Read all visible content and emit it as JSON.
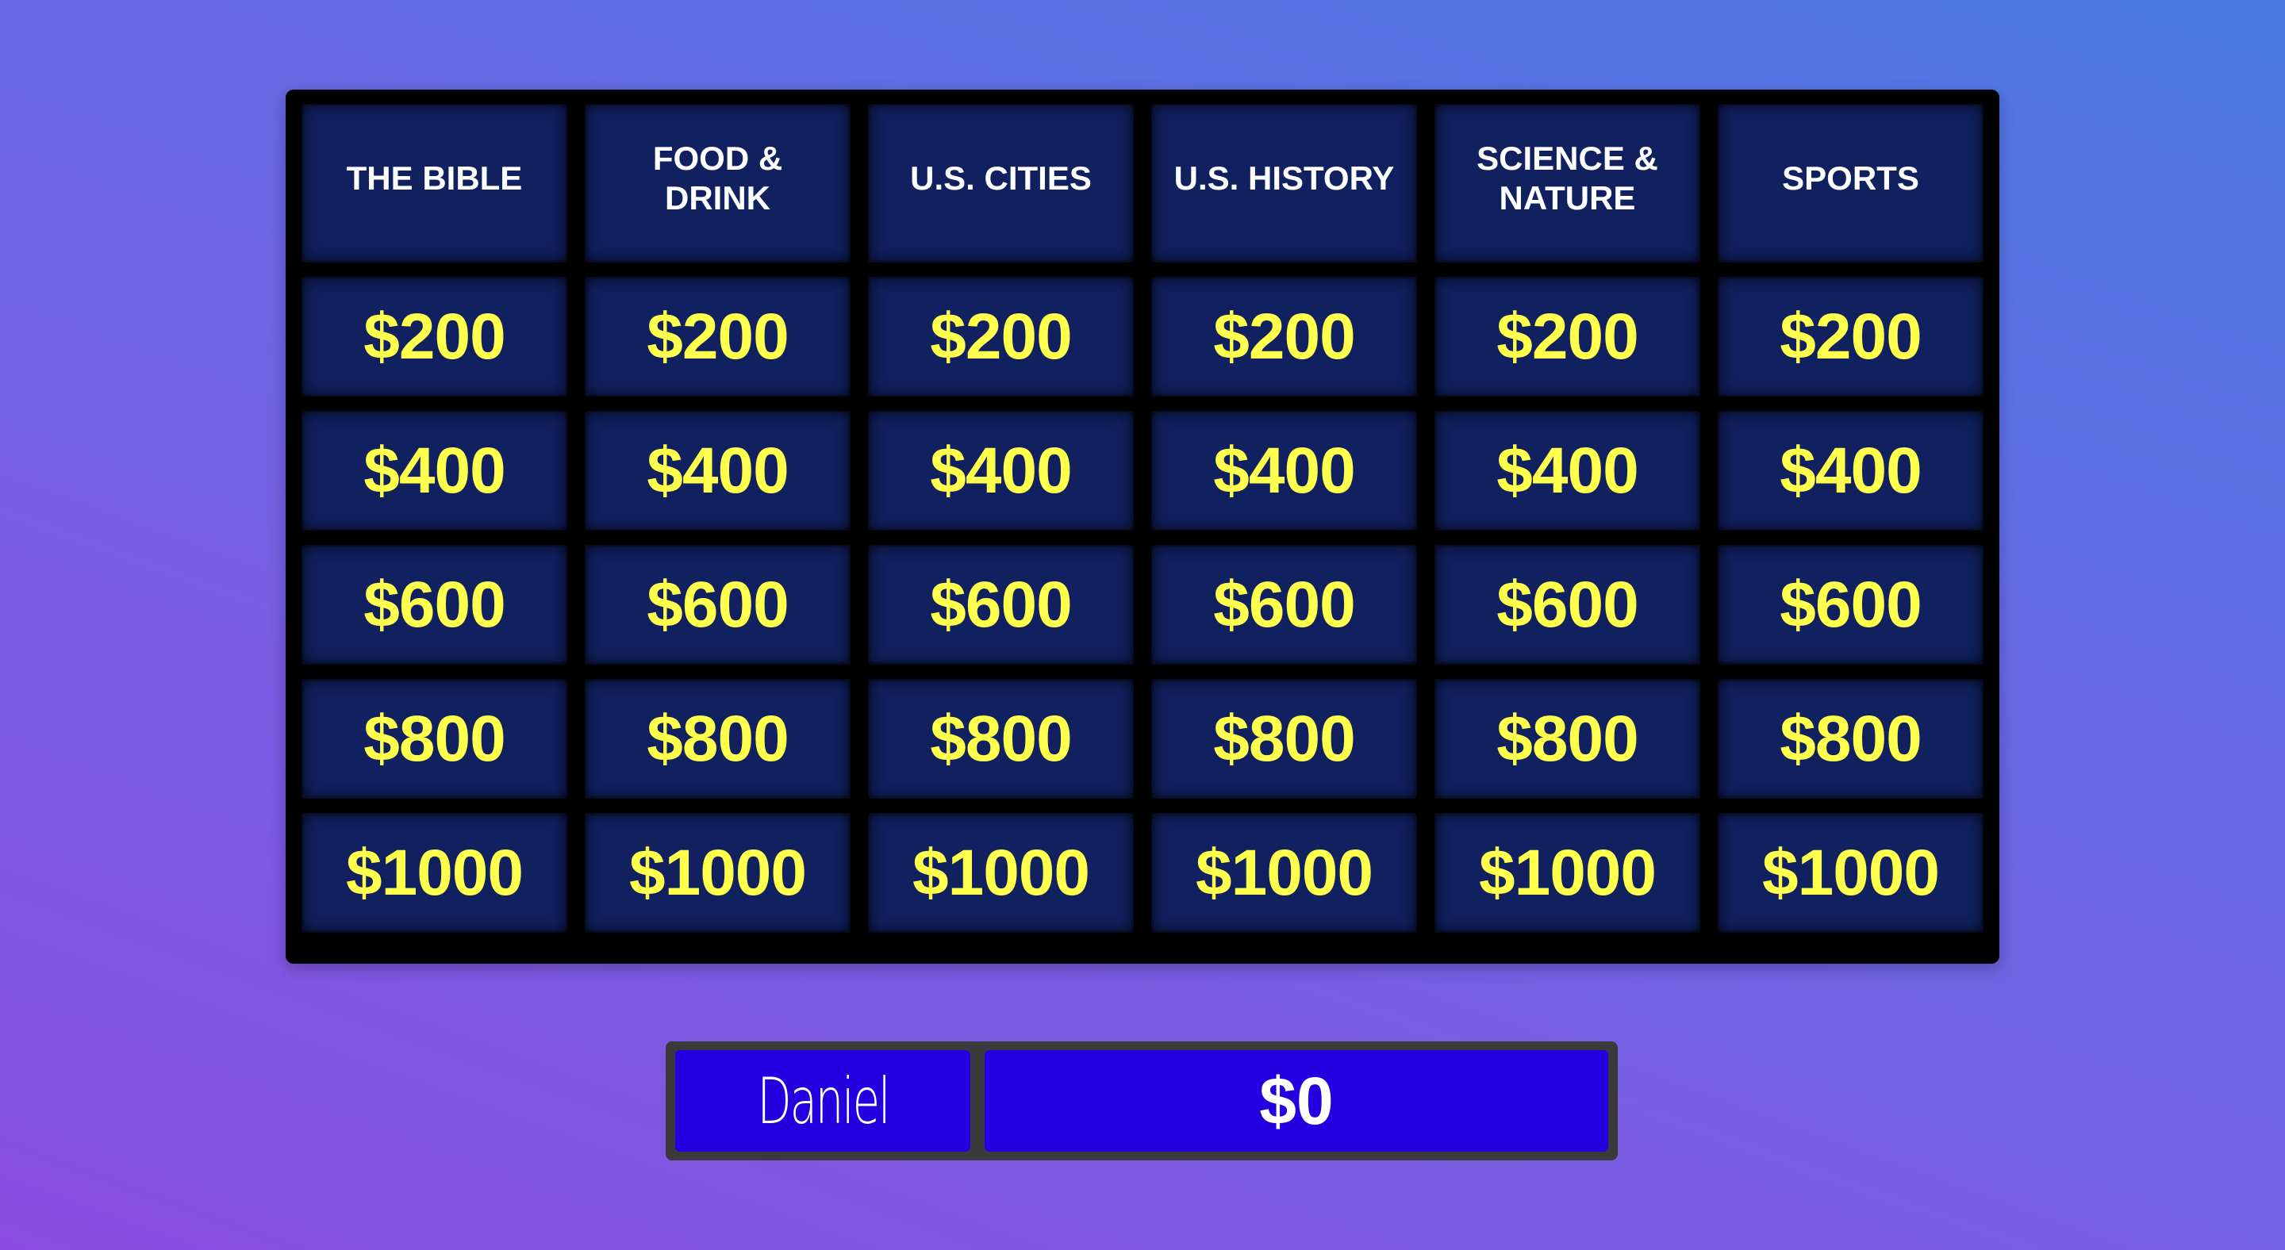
{
  "board": {
    "categories": [
      "THE BIBLE",
      "FOOD & DRINK",
      "U.S. CITIES",
      "U.S. HISTORY",
      "SCIENCE & NATURE",
      "SPORTS"
    ],
    "rows": [
      [
        "$200",
        "$200",
        "$200",
        "$200",
        "$200",
        "$200"
      ],
      [
        "$400",
        "$400",
        "$400",
        "$400",
        "$400",
        "$400"
      ],
      [
        "$600",
        "$600",
        "$600",
        "$600",
        "$600",
        "$600"
      ],
      [
        "$800",
        "$800",
        "$800",
        "$800",
        "$800",
        "$800"
      ],
      [
        "$1000",
        "$1000",
        "$1000",
        "$1000",
        "$1000",
        "$1000"
      ]
    ]
  },
  "player": {
    "name": "Daniel",
    "score": "$0"
  },
  "colors": {
    "tile": "#11205e",
    "value_text": "#ffff4d",
    "player_panel": "#2400e0"
  }
}
